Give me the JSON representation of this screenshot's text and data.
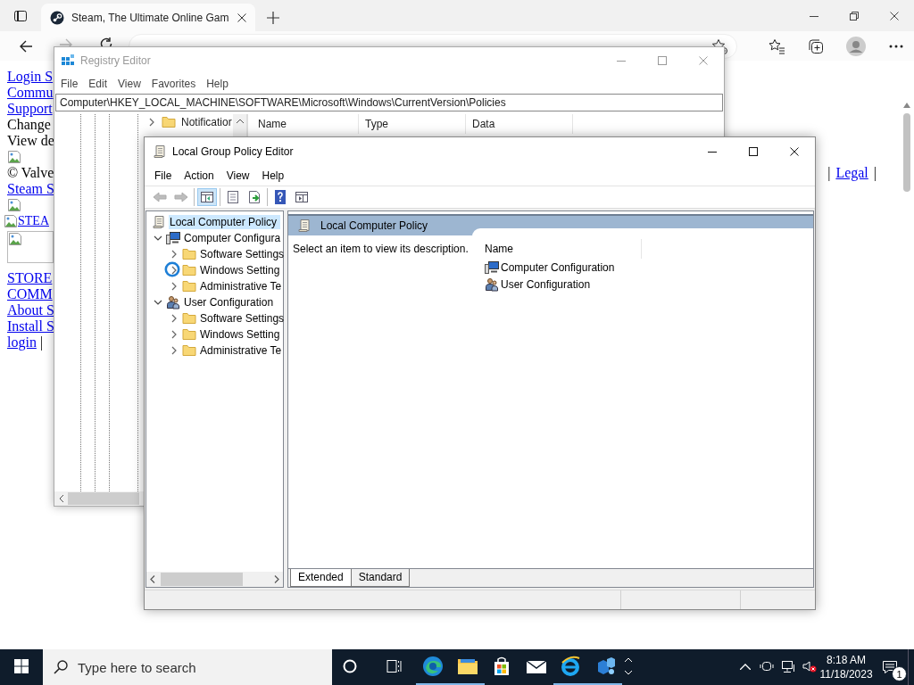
{
  "browser": {
    "tab": {
      "title": "Steam, The Ultimate Online Gam"
    },
    "lines": [
      {
        "parts": [
          {
            "kind": "link",
            "text": "Login S"
          }
        ]
      },
      {
        "parts": [
          {
            "kind": "link",
            "text": "Commu"
          }
        ]
      },
      {
        "parts": [
          {
            "kind": "link",
            "text": "Support"
          }
        ]
      },
      {
        "parts": [
          {
            "kind": "text",
            "text": "Change"
          }
        ]
      },
      {
        "parts": [
          {
            "kind": "text",
            "text": "View de"
          }
        ]
      },
      {
        "parts": [
          {
            "kind": "image"
          }
        ]
      },
      {
        "parts": [
          {
            "kind": "text",
            "text": "© Valve"
          }
        ],
        "right": [
          {
            "kind": "text",
            "text": "|"
          },
          {
            "kind": "link",
            "text": "Legal"
          },
          {
            "kind": "text",
            "text": "|"
          }
        ]
      },
      {
        "parts": [
          {
            "kind": "link",
            "text": "Steam S"
          }
        ]
      },
      {
        "parts": [
          {
            "kind": "image"
          }
        ]
      },
      {
        "parts": [
          {
            "kind": "image_link",
            "text": "STEA"
          }
        ]
      },
      {
        "parts": [
          {
            "kind": "image_frame"
          }
        ]
      },
      {
        "parts": [
          {
            "kind": "link",
            "text": "STORE"
          }
        ]
      },
      {
        "parts": [
          {
            "kind": "link",
            "text": "COMM"
          }
        ]
      },
      {
        "parts": [
          {
            "kind": "link",
            "text": "About S"
          }
        ]
      },
      {
        "parts": [
          {
            "kind": "link",
            "text": "Install S"
          }
        ]
      },
      {
        "parts": [
          {
            "kind": "link",
            "text": "login"
          },
          {
            "kind": "text",
            "text": "|"
          }
        ]
      }
    ]
  },
  "registry": {
    "title": "Registry Editor",
    "menu": [
      "File",
      "Edit",
      "View",
      "Favorites",
      "Help"
    ],
    "address": "Computer\\HKEY_LOCAL_MACHINE\\SOFTWARE\\Microsoft\\Windows\\CurrentVersion\\Policies",
    "tree": [
      {
        "label": "Notificatior",
        "expanded": false
      }
    ],
    "columns": [
      "Name",
      "Type",
      "Data"
    ]
  },
  "gpe": {
    "title": "Local Group Policy Editor",
    "menu": [
      "File",
      "Action",
      "View",
      "Help"
    ],
    "toolbar": [
      [
        {
          "kind": "back",
          "disabled": true,
          "pressed": false
        },
        {
          "kind": "forward",
          "disabled": true,
          "pressed": false
        }
      ],
      [
        {
          "kind": "tree",
          "disabled": false,
          "pressed": true
        }
      ],
      [
        {
          "kind": "properties",
          "disabled": false,
          "pressed": false
        },
        {
          "kind": "export",
          "disabled": false,
          "pressed": false
        }
      ],
      [
        {
          "kind": "help",
          "disabled": false,
          "pressed": false
        },
        {
          "kind": "action_pane",
          "disabled": false,
          "pressed": false
        }
      ]
    ],
    "tree": [
      {
        "label": "Local Computer Policy",
        "kind": "policy",
        "selected": true,
        "children": [
          {
            "label": "Computer Configura",
            "kind": "computer",
            "selected": false,
            "expanded": true,
            "children": [
              {
                "label": "Software Settings",
                "kind": "folder",
                "selected": false,
                "expanded": false
              },
              {
                "label": "Windows Setting",
                "kind": "folder",
                "selected": false,
                "expanded": false
              },
              {
                "label": "Administrative Te",
                "kind": "folder",
                "selected": false,
                "expanded": false
              }
            ]
          },
          {
            "label": "User Configuration",
            "kind": "user",
            "selected": false,
            "expanded": true,
            "children": [
              {
                "label": "Software Settings",
                "kind": "folder",
                "selected": false,
                "expanded": false
              },
              {
                "label": "Windows Setting",
                "kind": "folder",
                "selected": false,
                "expanded": false
              },
              {
                "label": "Administrative Te",
                "kind": "folder",
                "selected": false,
                "expanded": false
              }
            ]
          }
        ]
      }
    ],
    "heading": "Local Computer Policy",
    "description": "Select an item to view its description.",
    "columns": [
      "Name"
    ],
    "items": [
      {
        "label": "Computer Configuration",
        "kind": "computer"
      },
      {
        "label": "User Configuration",
        "kind": "user"
      }
    ],
    "tabs": [
      {
        "label": "Extended",
        "selected": true
      },
      {
        "label": "Standard",
        "selected": false
      }
    ]
  },
  "taskbar": {
    "search": {
      "placeholder": "Type here to search"
    },
    "apps": [
      {
        "kind": "edge",
        "running": true
      },
      {
        "kind": "explorer",
        "running": true
      },
      {
        "kind": "store",
        "running": false
      },
      {
        "kind": "mail",
        "running": false
      },
      {
        "kind": "ie",
        "running": true
      },
      {
        "kind": "app",
        "running": true
      }
    ],
    "time": "8:18 AM",
    "date": "11/18/2023",
    "notifications": "1"
  }
}
